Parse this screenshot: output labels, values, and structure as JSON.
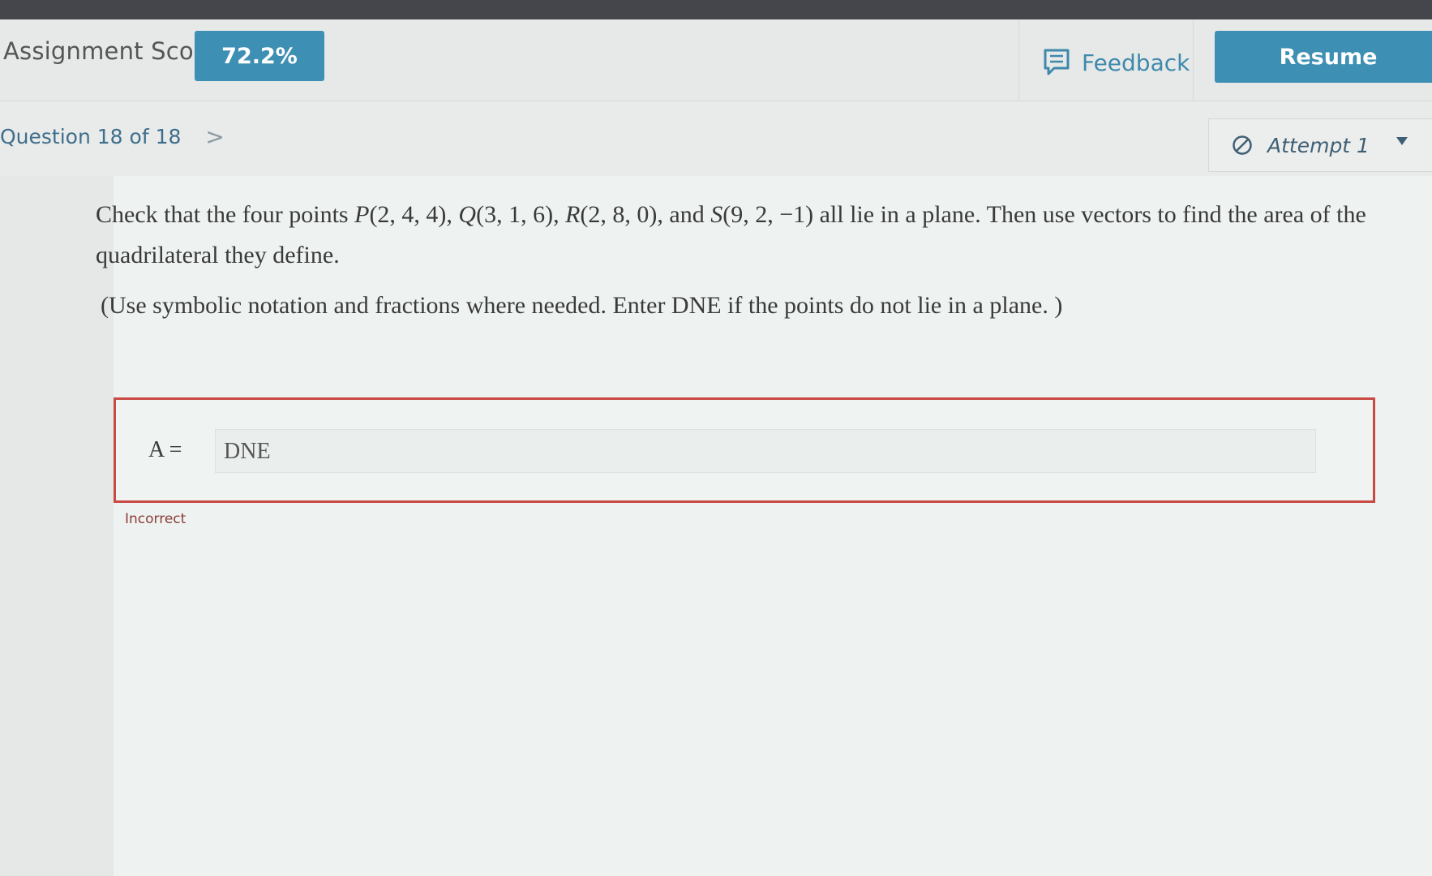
{
  "header": {
    "score_label": "Assignment Score:",
    "score_value": "72.2%",
    "feedback_label": "Feedback",
    "resume_label": "Resume"
  },
  "nav": {
    "question_position": "Question 18 of 18",
    "next_icon": "chevron-right-icon",
    "attempt_label": "Attempt 1"
  },
  "question": {
    "text_html": "Check that the four points <i>P</i>(2, 4, 4), <i>Q</i>(3, 1, 6), <i>R</i>(2, 8, 0), and <i>S</i>(9, 2, −1) all lie in a plane. Then use vectors to find the area of the quadrilateral they define.",
    "note": "(Use symbolic notation and fractions where needed. Enter DNE if the points do not lie in a plane. )"
  },
  "answer": {
    "label": "A =",
    "value": "DNE",
    "status": "Incorrect"
  },
  "colors": {
    "accent": "#3d8fb4",
    "error": "#c94a43"
  }
}
